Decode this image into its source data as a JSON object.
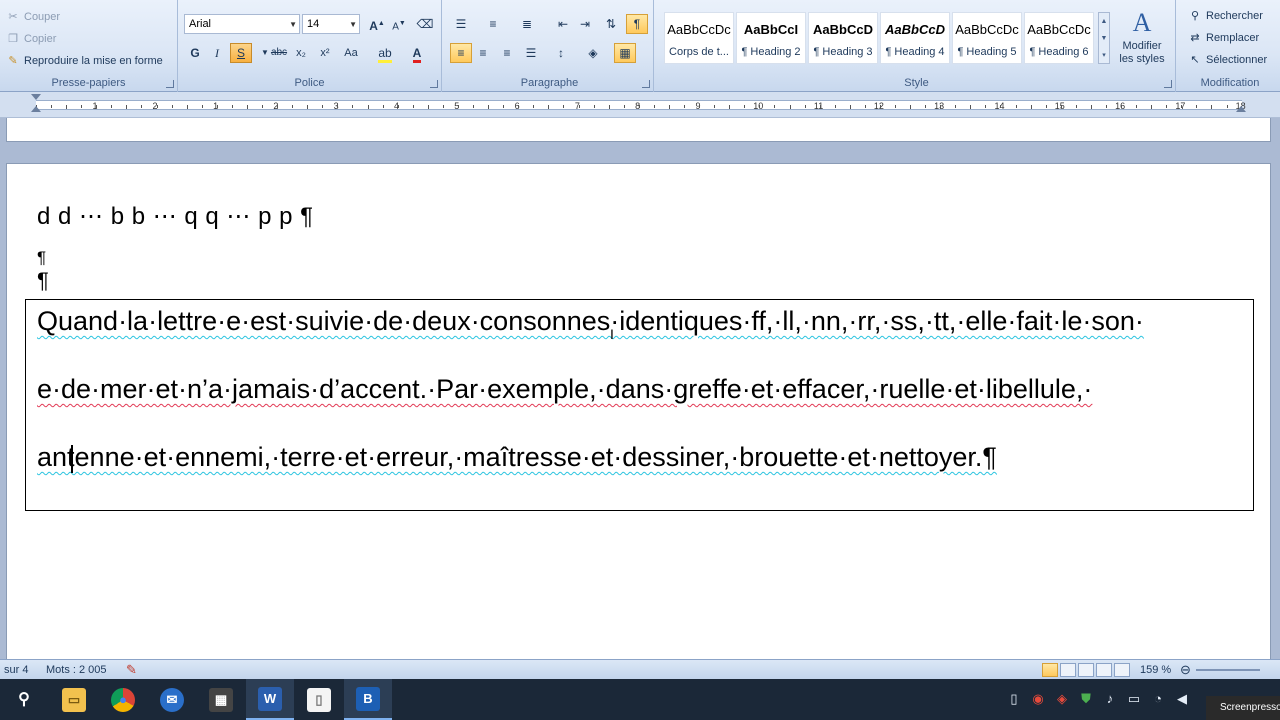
{
  "ribbon": {
    "clipboard": {
      "cut": "Couper",
      "copy": "Copier",
      "format_painter": "Reproduire la mise en forme",
      "label": "Presse-papiers"
    },
    "font": {
      "family": "Arial",
      "size": "14",
      "label": "Police",
      "bold": "G",
      "italic": "I",
      "underline": "S",
      "strike": "abc",
      "subscript": "x₂",
      "superscript": "x²",
      "change_case": "Aa"
    },
    "paragraph": {
      "label": "Paragraphe"
    },
    "styles": {
      "label": "Style",
      "items": [
        {
          "preview": "AaBbCcDc",
          "name": "Corps de t..."
        },
        {
          "preview": "AaBbCcI",
          "name": "¶ Heading 2"
        },
        {
          "preview": "AaBbCcD",
          "name": "¶ Heading 3"
        },
        {
          "preview": "AaBbCcD",
          "name": "¶ Heading 4"
        },
        {
          "preview": "AaBbCcDc",
          "name": "¶ Heading 5"
        },
        {
          "preview": "AaBbCcDc",
          "name": "¶ Heading 6"
        }
      ],
      "modify_line1": "Modifier",
      "modify_line2": "les styles"
    },
    "editing": {
      "find": "Rechercher",
      "replace": "Remplacer",
      "select": "Sélectionner",
      "label": "Modification"
    }
  },
  "ruler": {
    "numbers": [
      "1",
      "2",
      "1",
      "2",
      "3",
      "4",
      "5",
      "6",
      "7",
      "8",
      "9",
      "10",
      "11",
      "12",
      "13",
      "14",
      "15",
      "16",
      "17",
      "18",
      "19"
    ]
  },
  "document": {
    "cursive_line": "d d ⋯ b b ⋯ q q  ⋯ p p ¶",
    "pilcrow_1": "¶",
    "pilcrow_2": "¶",
    "textbox_lines": [
      "Quand·la·lettre·e·est·suivie·de·deux·consonnes·identiques·ff,·ll,·nn,·rr,·ss,·tt,·elle·fait·le·son·",
      "e·de·mer·et·n’a·jamais·d’accent.·Par·exemple,·dans·greffe·et·effacer,·ruelle·et·libellule,·",
      "antenne·et·ennemi,·terre·et·erreur,·maîtresse·et·dessiner,·brouette·et·nettoyer.¶"
    ]
  },
  "statusbar": {
    "page": "sur 4",
    "words": "Mots : 2 005",
    "zoom": "159 %"
  },
  "taskbar": {
    "brand": "Screenpresso"
  }
}
